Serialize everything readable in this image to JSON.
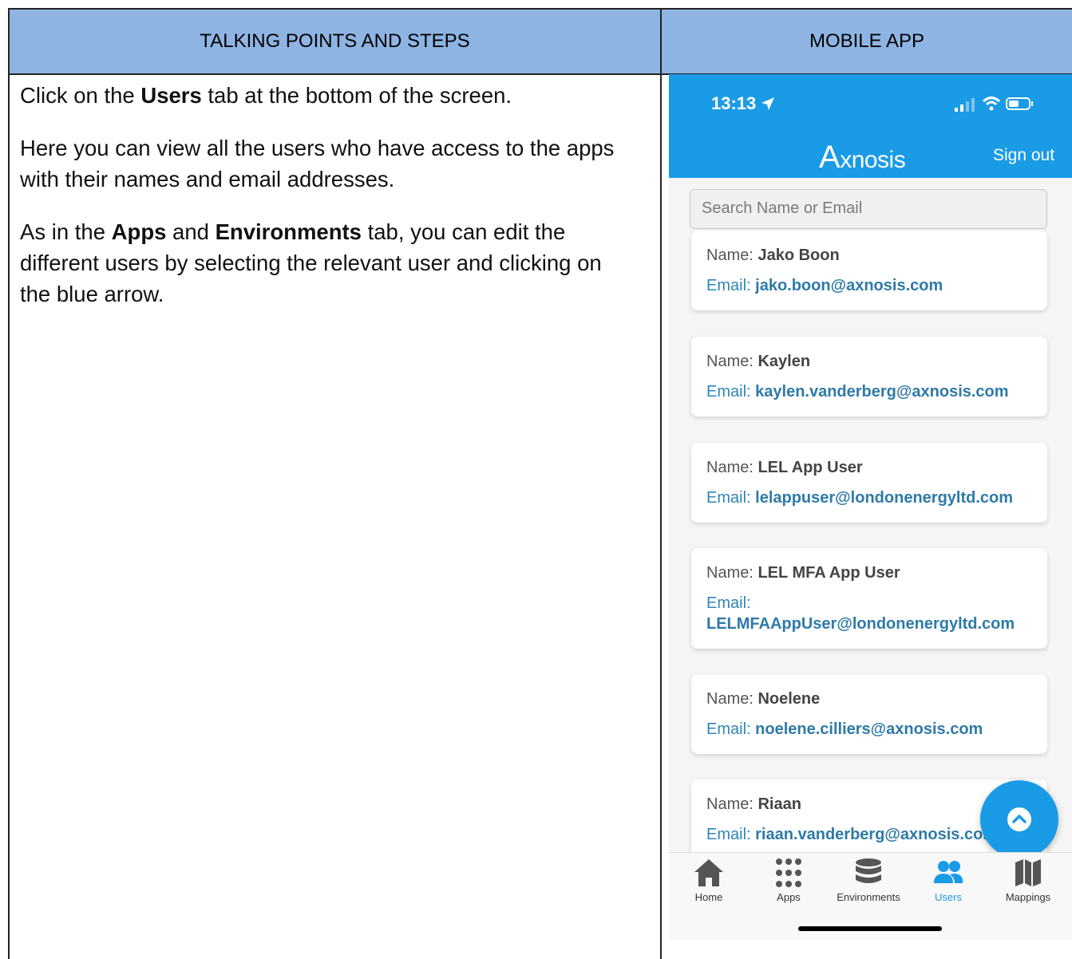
{
  "table": {
    "header_left": "TALKING POINTS AND STEPS",
    "header_right": "MOBILE APP"
  },
  "steps": {
    "p1_a": "Click on the ",
    "p1_b": "Users",
    "p1_c": " tab at the bottom of the screen.",
    "p2": "Here you can view all the users who have access to the apps with their names and email addresses.",
    "p3_a": "As in the ",
    "p3_b": "Apps",
    "p3_c": " and ",
    "p3_d": "Environments",
    "p3_e": " tab, you can edit the different users by selecting the relevant user and clicking on the blue arrow."
  },
  "phone": {
    "time": "13:13",
    "brand": "xnosis",
    "brand_a": "A",
    "signout": "Sign out",
    "search_placeholder": "Search Name or Email",
    "name_label": "Name:",
    "email_label": "Email:",
    "users": [
      {
        "name": "Jako Boon",
        "email": "jako.boon@axnosis.com"
      },
      {
        "name": "Kaylen",
        "email": "kaylen.vanderberg@axnosis.com"
      },
      {
        "name": "LEL App User",
        "email": "lelappuser@londonenergyltd.com"
      },
      {
        "name": "LEL MFA App User",
        "email": "LELMFAAppUser@londonenergyltd.com"
      },
      {
        "name": "Noelene",
        "email": "noelene.cilliers@axnosis.com"
      },
      {
        "name": "Riaan",
        "email": "riaan.vanderberg@axnosis.com"
      }
    ],
    "tabs": [
      {
        "label": "Home",
        "icon": "home-icon"
      },
      {
        "label": "Apps",
        "icon": "apps-grid-icon"
      },
      {
        "label": "Environments",
        "icon": "database-icon"
      },
      {
        "label": "Users",
        "icon": "users-icon"
      },
      {
        "label": "Mappings",
        "icon": "map-icon"
      }
    ],
    "colors": {
      "accent": "#1a9be6",
      "email": "#2e7aa8"
    }
  }
}
